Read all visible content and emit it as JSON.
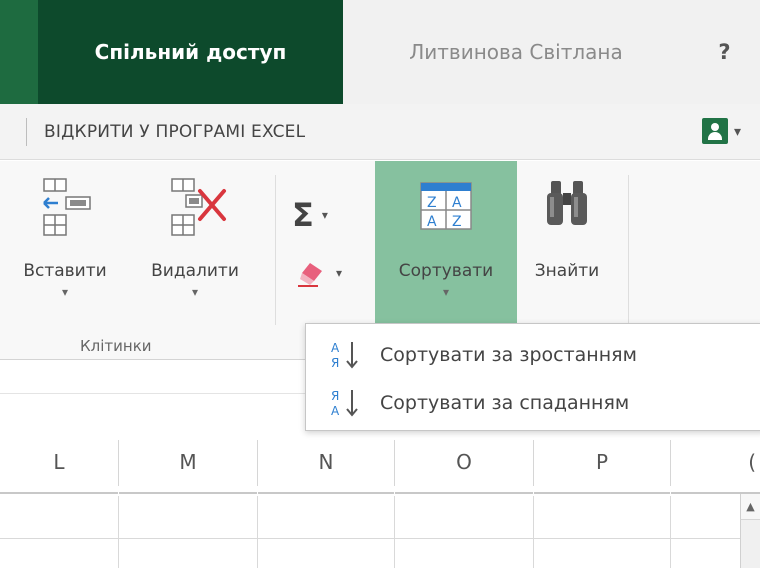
{
  "tabs": {
    "active": "Спільний доступ",
    "user": "Литвинова Світлана",
    "help": "?"
  },
  "commands": {
    "open_in_excel": "ВІДКРИТИ У ПРОГРАМІ EXCEL",
    "user_caret": "▾"
  },
  "ribbon": {
    "insert": "Вставити",
    "delete": "Видалити",
    "cells_group": "Клітинки",
    "sum_icon": "Σ",
    "sort": "Сортувати",
    "find": "Знайти",
    "caret": "▾"
  },
  "sort_menu": {
    "ascending": "Сортувати за зростанням",
    "descending": "Сортувати за спаданням"
  },
  "columns": [
    "L",
    "M",
    "N",
    "O",
    "P",
    "("
  ],
  "scroll_up": "▲",
  "colors": {
    "accent": "#217346",
    "dark_tab": "#0d4a2c",
    "sort_highlight": "#86c19f",
    "delete_red": "#d9363e"
  },
  "icons": {
    "insert": "insert-cells-icon",
    "delete": "delete-cells-icon",
    "autosum": "sigma-icon",
    "clear": "eraser-icon",
    "sort": "sort-az-icon",
    "find": "binoculars-icon",
    "ascending": "sort-ascending-icon",
    "descending": "sort-descending-icon",
    "user": "user-icon"
  }
}
